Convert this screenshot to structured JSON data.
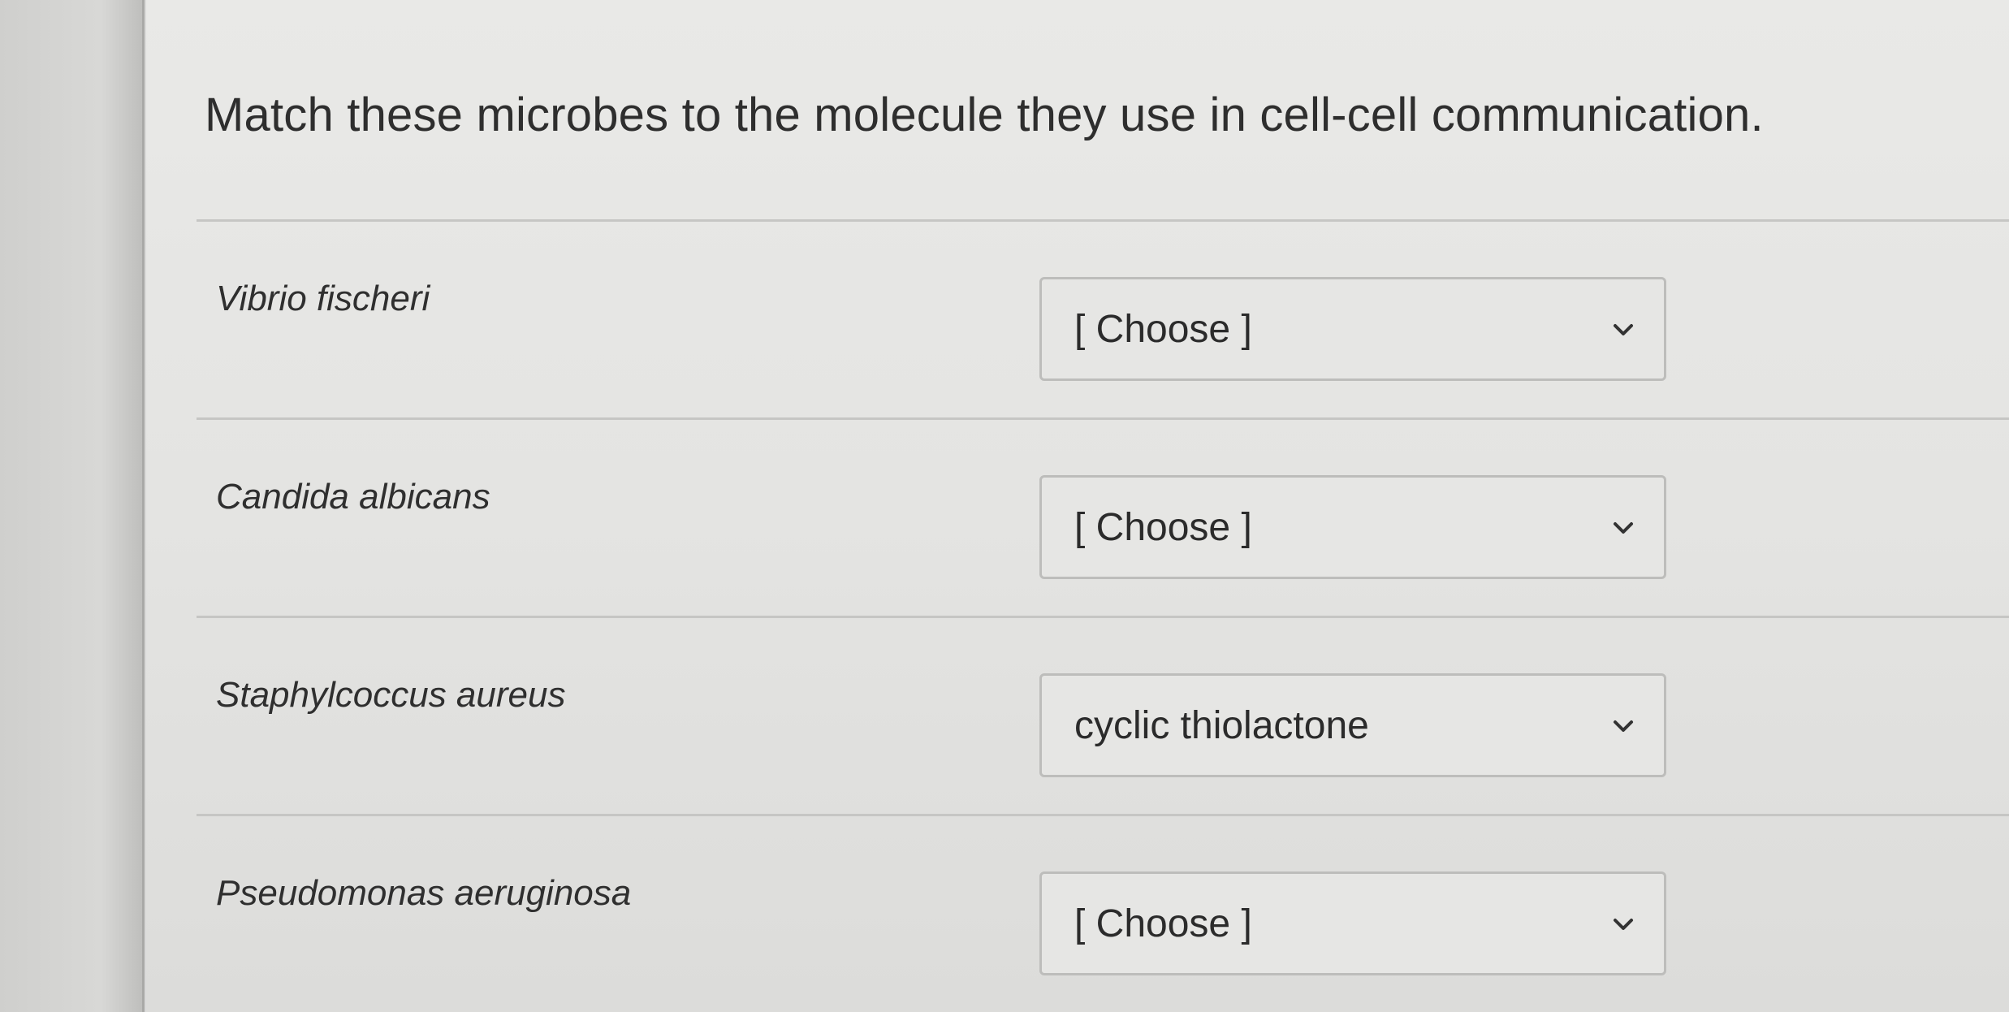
{
  "question": {
    "title": "Match these microbes to the molecule they use in cell-cell communication."
  },
  "rows": [
    {
      "label": "Vibrio fischeri",
      "selected": "[ Choose ]"
    },
    {
      "label": "Candida albicans",
      "selected": "[ Choose ]"
    },
    {
      "label": "Staphylcoccus aureus",
      "selected": "cyclic thiolactone"
    },
    {
      "label": "Pseudomonas aeruginosa",
      "selected": "[ Choose ]"
    }
  ],
  "icons": {
    "dropdown": "chevron-down-icon"
  },
  "colors": {
    "text": "#2e2e2e",
    "border": "#bdbdbb",
    "background": "#e6e6e4"
  }
}
